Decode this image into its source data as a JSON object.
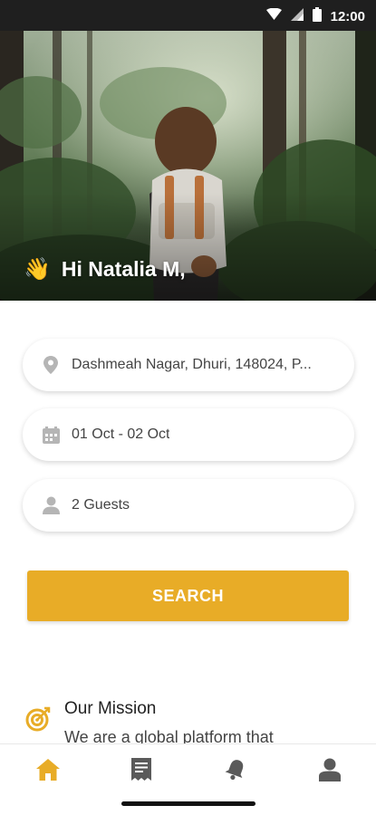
{
  "status_bar": {
    "time": "12:00",
    "icons": [
      "wifi-icon",
      "signal-icon",
      "battery-icon"
    ]
  },
  "hero": {
    "greeting_emoji": "👋",
    "greeting": "Hi Natalia M,"
  },
  "search_form": {
    "location": {
      "icon": "location-pin-icon",
      "value": "Dashmeah Nagar, Dhuri, 148024, P..."
    },
    "dates": {
      "icon": "calendar-icon",
      "value": "01 Oct - 02 Oct"
    },
    "guests": {
      "icon": "person-icon",
      "value": "2 Guests"
    },
    "search_label": "SEARCH"
  },
  "mission": {
    "icon": "target-icon",
    "title": "Our Mission",
    "text": "We are a global platform that"
  },
  "bottom_nav": {
    "items": [
      {
        "icon": "home-icon",
        "active": true
      },
      {
        "icon": "receipt-icon",
        "active": false
      },
      {
        "icon": "bell-icon",
        "active": false
      },
      {
        "icon": "profile-icon",
        "active": false
      }
    ]
  },
  "colors": {
    "accent": "#e8ac27",
    "inactive_icon": "#5a5a5a",
    "field_icon": "#b5b5b5",
    "status_bar": "#1f1f1f"
  }
}
